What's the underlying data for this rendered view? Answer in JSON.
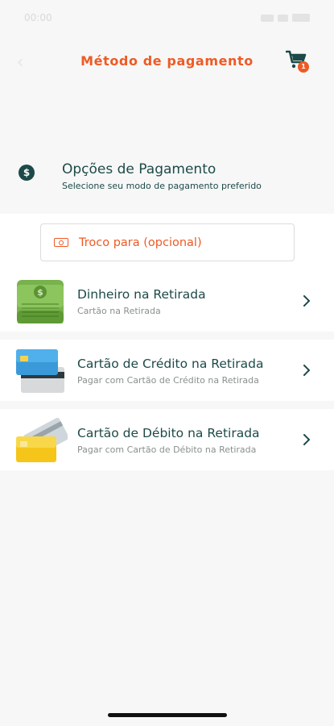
{
  "status_bar": {
    "time": "00:00"
  },
  "header": {
    "title": "Método de pagamento",
    "cart_count": "1"
  },
  "section": {
    "title": "Opções de Pagamento",
    "subtitle": "Selecione seu modo de pagamento preferido"
  },
  "change_field": {
    "label": "Troco para (opcional)"
  },
  "payment_options": [
    {
      "title": "Dinheiro na Retirada",
      "subtitle": "Cartão na Retirada",
      "icon": "cash-icon"
    },
    {
      "title": "Cartão de Crédito na Retirada",
      "subtitle": "Pagar com Cartão de Crédito na Retirada",
      "icon": "credit-card-icon"
    },
    {
      "title": "Cartão de Débito na Retirada",
      "subtitle": "Pagar com Cartão de Débito na Retirada",
      "icon": "debit-card-icon"
    }
  ],
  "colors": {
    "accent": "#ef5a24",
    "primary_text": "#1d4a48",
    "secondary_text": "#8a8f8f",
    "background": "#f7f7f7"
  }
}
